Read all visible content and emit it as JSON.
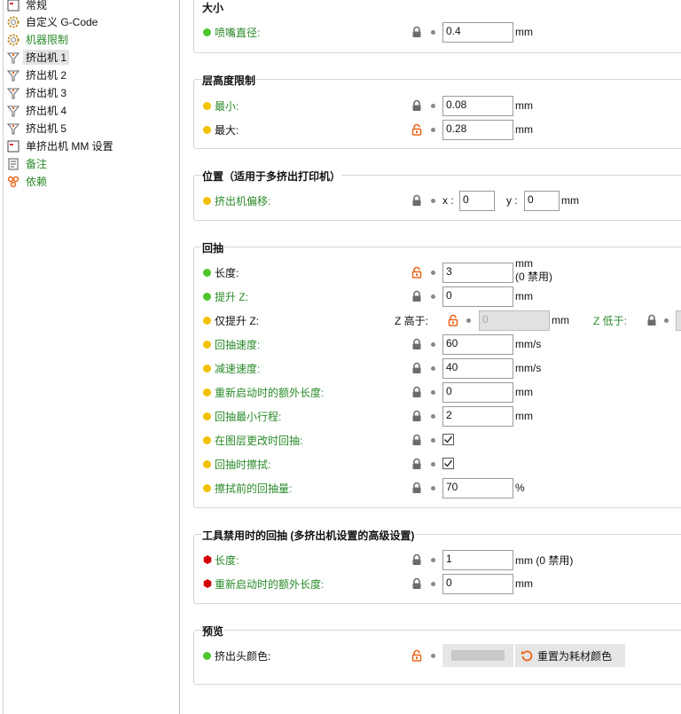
{
  "sidebar": {
    "items": [
      {
        "label": "常规",
        "icon": "printer-icon",
        "green": false,
        "selected": false
      },
      {
        "label": "自定义 G-Code",
        "icon": "gcode-cog-icon",
        "green": false,
        "selected": false
      },
      {
        "label": "机器限制",
        "icon": "machine-limits-cog-icon",
        "green": true,
        "selected": false
      },
      {
        "label": "挤出机 1",
        "icon": "extruder-icon",
        "green": false,
        "selected": true
      },
      {
        "label": "挤出机 2",
        "icon": "extruder-icon",
        "green": false,
        "selected": false
      },
      {
        "label": "挤出机 3",
        "icon": "extruder-icon",
        "green": false,
        "selected": false
      },
      {
        "label": "挤出机 4",
        "icon": "extruder-icon",
        "green": false,
        "selected": false
      },
      {
        "label": "挤出机 5",
        "icon": "extruder-icon",
        "green": false,
        "selected": false
      },
      {
        "label": "单挤出机 MM 设置",
        "icon": "printer-icon",
        "green": false,
        "selected": false
      },
      {
        "label": "备注",
        "icon": "notes-icon",
        "green": true,
        "selected": false
      },
      {
        "label": "依赖",
        "icon": "dependencies-icon",
        "green": true,
        "selected": false
      }
    ]
  },
  "groups": {
    "size": {
      "title": "大小",
      "nozzle": {
        "label": "喷嘴直径:",
        "value": "0.4",
        "unit": "mm"
      }
    },
    "layer": {
      "title": "层高度限制",
      "min": {
        "label": "最小:",
        "value": "0.08",
        "unit": "mm"
      },
      "max": {
        "label": "最大:",
        "value": "0.28",
        "unit": "mm"
      }
    },
    "position": {
      "title": "位置（适用于多挤出打印机）",
      "offset": {
        "label": "挤出机偏移:",
        "x_label": "x :",
        "x": "0",
        "y_label": "y :",
        "y": "0",
        "unit": "mm"
      }
    },
    "retraction": {
      "title": "回抽",
      "length": {
        "label": "长度:",
        "value": "3",
        "unit": "mm",
        "note": "(0 禁用)"
      },
      "lift_z": {
        "label": "提升 Z:",
        "value": "0",
        "unit": "mm"
      },
      "only_lift": {
        "label": "仅提升 Z:",
        "above_label": "Z 高于:",
        "above_value": "0",
        "unit": "mm",
        "below_label": "Z 低于:"
      },
      "speed": {
        "label": "回抽速度:",
        "value": "60",
        "unit": "mm/s"
      },
      "deretract": {
        "label": "减速速度:",
        "value": "40",
        "unit": "mm/s"
      },
      "restart_extra": {
        "label": "重新启动时的额外长度:",
        "value": "0",
        "unit": "mm"
      },
      "min_travel": {
        "label": "回抽最小行程:",
        "value": "2",
        "unit": "mm"
      },
      "layer_change": {
        "label": "在图层更改时回抽:",
        "checked": true
      },
      "wipe": {
        "label": "回抽时擦拭:",
        "checked": true
      },
      "before_wipe": {
        "label": "擦拭前的回抽量:",
        "value": "70",
        "unit": "%"
      }
    },
    "toolchange": {
      "title": "工具禁用时的回抽 (多挤出机设置的高级设置)",
      "length": {
        "label": "长度:",
        "value": "1",
        "unit": "mm (0 禁用)"
      },
      "restart_extra": {
        "label": "重新启动时的额外长度:",
        "value": "0",
        "unit": "mm"
      }
    },
    "preview": {
      "title": "预览",
      "color": {
        "label": "挤出头颜色:",
        "reset_label": "重置为耗材颜色"
      }
    }
  },
  "colors": {
    "green_label": "#2a8a2a",
    "lock_orange": "#e8641a",
    "lock_gray": "#6b6b6b"
  }
}
